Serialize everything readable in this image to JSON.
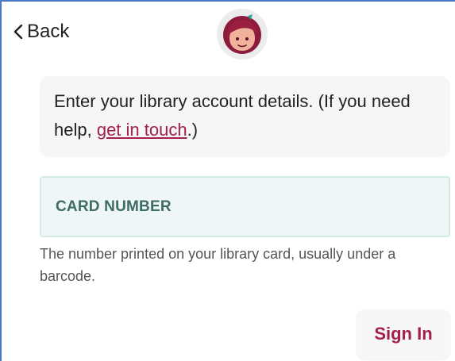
{
  "header": {
    "back_label": "Back",
    "back_icon": "chevron-left-icon",
    "logo_icon": "libby-logo-icon"
  },
  "instructions": {
    "text_before": "Enter your library account details. (If you need help, ",
    "link_text": "get in touch",
    "text_after": ".)"
  },
  "card_number": {
    "label": "CARD NUMBER",
    "help_text": "The number printed on your library card, usually under a barcode."
  },
  "actions": {
    "sign_in_label": "Sign In"
  },
  "colors": {
    "accent": "#a3204a",
    "field_background": "#eef7f6",
    "field_label": "#3e6b66",
    "frame_border": "#4a78c2"
  }
}
